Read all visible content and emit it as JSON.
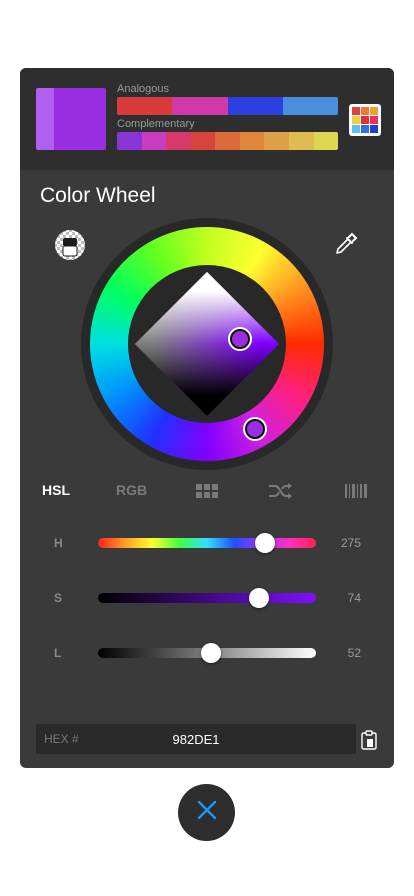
{
  "preview": {
    "previous_color": "#b25ff0",
    "current_color": "#982DE1"
  },
  "harmony": {
    "analogous_label": "Analogous",
    "analogous": [
      "#d93a3a",
      "#d03aa8",
      "#2e3fe0",
      "#4a8ee0"
    ],
    "complementary_label": "Complementary",
    "complementary": [
      "#8a34d8",
      "#c83cc0",
      "#d8386a",
      "#d8443c",
      "#dc6a3a",
      "#e0873c",
      "#e0a048",
      "#e0bc50",
      "#dcd650"
    ]
  },
  "palette_icon": {
    "name": "palette-grid-icon",
    "colors": [
      "#e84040",
      "#f07830",
      "#f0a030",
      "#f0d040",
      "#e03030",
      "#e83060",
      "#60c0f0",
      "#3070e0",
      "#2040d0"
    ]
  },
  "title": "Color Wheel",
  "tools": {
    "transparency": "transparency-checker-icon",
    "eyedropper": "eyedropper-icon"
  },
  "tabs": [
    {
      "label": "HSL",
      "active": true
    },
    {
      "label": "RGB",
      "active": false
    },
    {
      "icon": "grid-icon"
    },
    {
      "icon": "shuffle-icon"
    },
    {
      "icon": "barcode-icon"
    }
  ],
  "sliders": {
    "h": {
      "label": "H",
      "value": "275",
      "fraction": 0.764
    },
    "s": {
      "label": "S",
      "value": "74",
      "fraction": 0.74
    },
    "l": {
      "label": "L",
      "value": "52",
      "fraction": 0.52
    }
  },
  "hex": {
    "label": "HEX #",
    "value": "982DE1"
  },
  "close": {
    "icon": "close-icon",
    "color": "#2196f3"
  }
}
